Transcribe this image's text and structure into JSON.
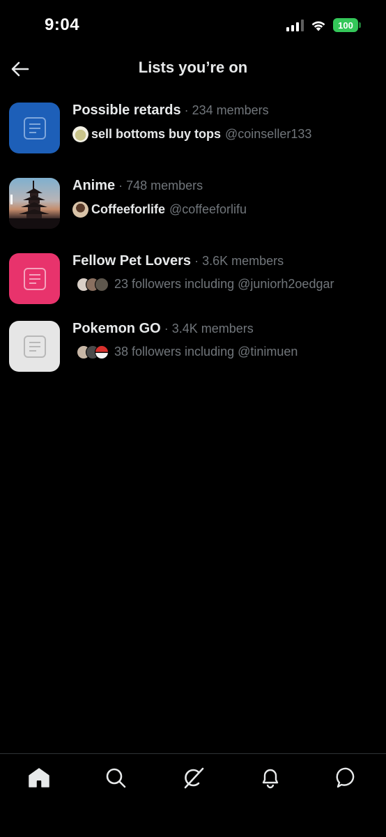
{
  "status_bar": {
    "time": "9:04",
    "battery": "100",
    "icons": [
      "cellular-signal-icon",
      "wifi-icon",
      "battery-icon"
    ]
  },
  "header": {
    "title": "Lists you’re on",
    "back_icon": "arrow-left-icon"
  },
  "lists": [
    {
      "name": "Possible retards",
      "separator": "·",
      "members": "234 members",
      "owner_name": "sell bottoms buy tops",
      "owner_handle": "@coinseller133",
      "thumb_color": "#1d5fb8",
      "thumb_icon": "list-document-icon"
    },
    {
      "name": "Anime",
      "separator": "·",
      "members": "748 members",
      "owner_name": "Coffeeforlife",
      "owner_handle": "@coffeeforlifu",
      "thumb_icon": "pagoda-photo"
    },
    {
      "name": "Fellow Pet Lovers",
      "separator": "·",
      "members": "3.6K members",
      "followers_text": "23 followers including @juniorh2oedgar",
      "thumb_color": "#e8336c",
      "thumb_icon": "list-document-icon"
    },
    {
      "name": "Pokemon GO",
      "separator": "·",
      "members": "3.4K members",
      "followers_text": "38 followers including @tinimuen",
      "thumb_color": "#e6e6e6",
      "thumb_icon": "list-document-icon"
    }
  ],
  "bottom_nav": {
    "items": [
      "home-icon",
      "search-icon",
      "grok-icon",
      "notifications-icon",
      "messages-icon"
    ],
    "active": "home-icon"
  },
  "colors": {
    "background": "#000000",
    "primary_text": "#e7e9ea",
    "secondary_text": "#71767b",
    "divider": "#2f3336"
  }
}
